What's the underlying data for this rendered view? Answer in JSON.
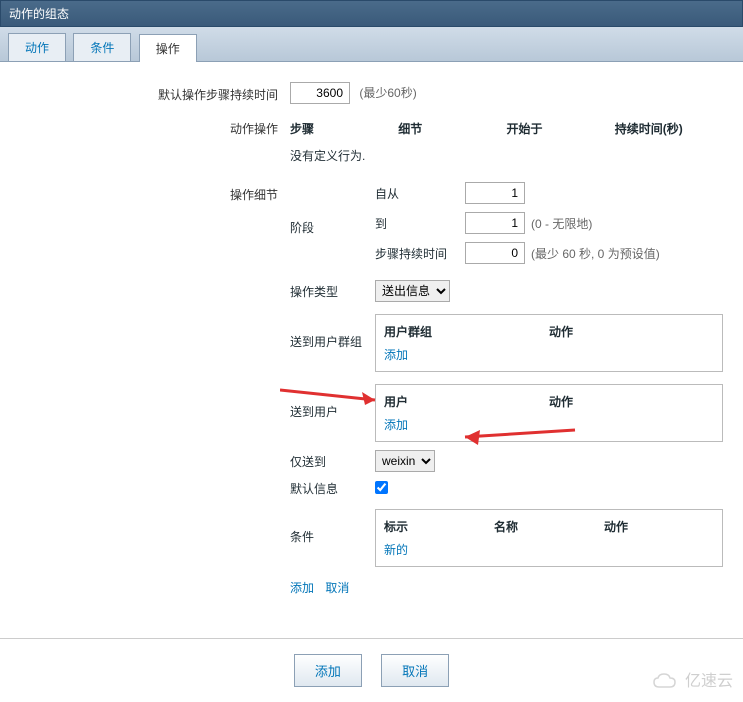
{
  "header": {
    "title": "动作的组态"
  },
  "tabs": {
    "items": [
      "动作",
      "条件",
      "操作"
    ],
    "activeIndex": 2
  },
  "form": {
    "default_duration": {
      "label": "默认操作步骤持续时间",
      "value": "3600",
      "hint": "(最少60秒)"
    },
    "action_ops": {
      "label": "动作操作",
      "headers": [
        "步骤",
        "细节",
        "开始于",
        "持续时间(秒)"
      ],
      "empty_text": "没有定义行为."
    },
    "detail": {
      "label": "操作细节",
      "stage": {
        "label": "阶段",
        "from_label": "自从",
        "from_value": "1",
        "to_label": "到",
        "to_value": "1",
        "to_hint": "(0 - 无限地)",
        "dur_label": "步骤持续时间",
        "dur_value": "0",
        "dur_hint": "(最少 60 秒, 0 为预设值)"
      },
      "op_type": {
        "label": "操作类型",
        "value": "送出信息",
        "options": [
          "送出信息"
        ]
      },
      "send_group": {
        "label": "送到用户群组",
        "col1": "用户群组",
        "col2": "动作",
        "add": "添加"
      },
      "send_user": {
        "label": "送到用户",
        "col1": "用户",
        "col2": "动作",
        "add": "添加"
      },
      "only_send": {
        "label": "仅送到",
        "value": "weixin",
        "options": [
          "weixin"
        ]
      },
      "default_msg": {
        "label": "默认信息",
        "checked": true
      },
      "conditions": {
        "label": "条件",
        "col1": "标示",
        "col2": "名称",
        "col3": "动作",
        "new": "新的"
      },
      "actions": {
        "add": "添加",
        "cancel": "取消"
      }
    }
  },
  "buttons": {
    "add": "添加",
    "cancel": "取消"
  },
  "watermark": "亿速云"
}
